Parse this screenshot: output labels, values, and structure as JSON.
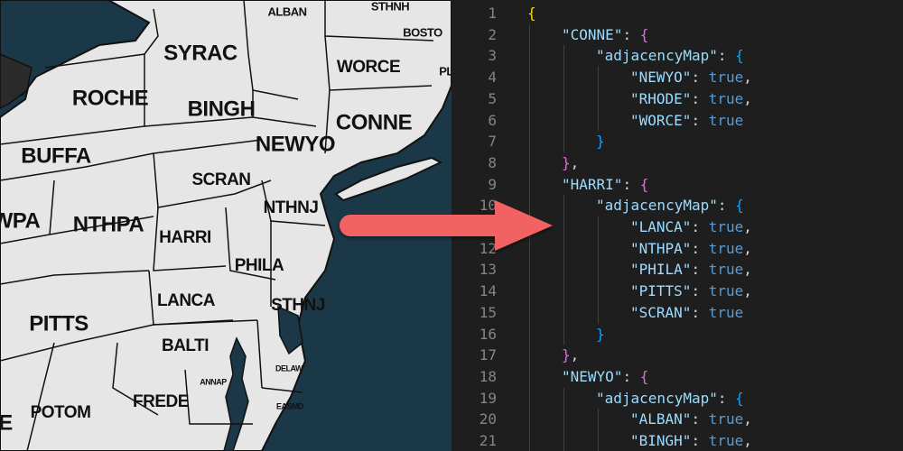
{
  "map": {
    "labels": [
      {
        "id": "alban",
        "text": "ALBAN",
        "size": "small"
      },
      {
        "id": "sthnh",
        "text": "STHNH",
        "size": "small"
      },
      {
        "id": "bosto",
        "text": "BOSTO",
        "size": "small"
      },
      {
        "id": "syrac",
        "text": "SYRAC",
        "size": "large"
      },
      {
        "id": "worce",
        "text": "WORCE",
        "size": "medium"
      },
      {
        "id": "pl",
        "text": "PL",
        "size": "small"
      },
      {
        "id": "roche",
        "text": "ROCHE",
        "size": "large"
      },
      {
        "id": "bingh",
        "text": "BINGH",
        "size": "large"
      },
      {
        "id": "conne",
        "text": "CONNE",
        "size": "large"
      },
      {
        "id": "buffa",
        "text": "BUFFA",
        "size": "large"
      },
      {
        "id": "newyo",
        "text": "NEWYO",
        "size": "large"
      },
      {
        "id": "scran",
        "text": "SCRAN",
        "size": "medium"
      },
      {
        "id": "nthnj",
        "text": "NTHNJ",
        "size": "medium"
      },
      {
        "id": "wpa",
        "text": "WPA",
        "size": "large"
      },
      {
        "id": "nthpa",
        "text": "NTHPA",
        "size": "large"
      },
      {
        "id": "harri",
        "text": "HARRI",
        "size": "medium"
      },
      {
        "id": "phila",
        "text": "PHILA",
        "size": "medium"
      },
      {
        "id": "lanca",
        "text": "LANCA",
        "size": "medium"
      },
      {
        "id": "sthnj",
        "text": "STHNJ",
        "size": "medium"
      },
      {
        "id": "pitts",
        "text": "PITTS",
        "size": "large"
      },
      {
        "id": "balti",
        "text": "BALTI",
        "size": "medium"
      },
      {
        "id": "delaw",
        "text": "DELAW",
        "size": "tiny"
      },
      {
        "id": "annap",
        "text": "ANNAP",
        "size": "tiny"
      },
      {
        "id": "easmd",
        "text": "EASMD",
        "size": "tiny"
      },
      {
        "id": "frede",
        "text": "FREDE",
        "size": "medium"
      },
      {
        "id": "potom",
        "text": "POTOM",
        "size": "medium"
      },
      {
        "id": "e",
        "text": "E",
        "size": "large"
      }
    ]
  },
  "arrow": {
    "color": "#f26262",
    "direction": "right"
  },
  "code": {
    "lines": [
      {
        "n": "1",
        "indent": 0,
        "tokens": [
          {
            "t": "{",
            "c": "b1"
          }
        ]
      },
      {
        "n": "2",
        "indent": 1,
        "tokens": [
          {
            "t": "\"CONNE\"",
            "c": "k"
          },
          {
            "t": ": ",
            "c": "p"
          },
          {
            "t": "{",
            "c": "b2"
          }
        ]
      },
      {
        "n": "3",
        "indent": 2,
        "tokens": [
          {
            "t": "\"adjacencyMap\"",
            "c": "k"
          },
          {
            "t": ": ",
            "c": "p"
          },
          {
            "t": "{",
            "c": "b3"
          }
        ]
      },
      {
        "n": "4",
        "indent": 3,
        "tokens": [
          {
            "t": "\"NEWYO\"",
            "c": "k"
          },
          {
            "t": ": ",
            "c": "p"
          },
          {
            "t": "true",
            "c": "kw"
          },
          {
            "t": ",",
            "c": "p"
          }
        ]
      },
      {
        "n": "5",
        "indent": 3,
        "tokens": [
          {
            "t": "\"RHODE\"",
            "c": "k"
          },
          {
            "t": ": ",
            "c": "p"
          },
          {
            "t": "true",
            "c": "kw"
          },
          {
            "t": ",",
            "c": "p"
          }
        ]
      },
      {
        "n": "6",
        "indent": 3,
        "tokens": [
          {
            "t": "\"WORCE\"",
            "c": "k"
          },
          {
            "t": ": ",
            "c": "p"
          },
          {
            "t": "true",
            "c": "kw"
          }
        ]
      },
      {
        "n": "7",
        "indent": 2,
        "tokens": [
          {
            "t": "}",
            "c": "b3"
          }
        ]
      },
      {
        "n": "8",
        "indent": 1,
        "tokens": [
          {
            "t": "}",
            "c": "b2"
          },
          {
            "t": ",",
            "c": "p"
          }
        ]
      },
      {
        "n": "9",
        "indent": 1,
        "tokens": [
          {
            "t": "\"HARRI\"",
            "c": "k"
          },
          {
            "t": ": ",
            "c": "p"
          },
          {
            "t": "{",
            "c": "b2"
          }
        ]
      },
      {
        "n": "10",
        "indent": 2,
        "tokens": [
          {
            "t": "\"adjacencyMap\"",
            "c": "k"
          },
          {
            "t": ": ",
            "c": "p"
          },
          {
            "t": "{",
            "c": "b3"
          }
        ]
      },
      {
        "n": "11",
        "indent": 3,
        "tokens": [
          {
            "t": "\"LANCA\"",
            "c": "k"
          },
          {
            "t": ": ",
            "c": "p"
          },
          {
            "t": "true",
            "c": "kw"
          },
          {
            "t": ",",
            "c": "p"
          }
        ]
      },
      {
        "n": "12",
        "indent": 3,
        "tokens": [
          {
            "t": "\"NTHPA\"",
            "c": "k"
          },
          {
            "t": ": ",
            "c": "p"
          },
          {
            "t": "true",
            "c": "kw"
          },
          {
            "t": ",",
            "c": "p"
          }
        ]
      },
      {
        "n": "13",
        "indent": 3,
        "tokens": [
          {
            "t": "\"PHILA\"",
            "c": "k"
          },
          {
            "t": ": ",
            "c": "p"
          },
          {
            "t": "true",
            "c": "kw"
          },
          {
            "t": ",",
            "c": "p"
          }
        ]
      },
      {
        "n": "14",
        "indent": 3,
        "tokens": [
          {
            "t": "\"PITTS\"",
            "c": "k"
          },
          {
            "t": ": ",
            "c": "p"
          },
          {
            "t": "true",
            "c": "kw"
          },
          {
            "t": ",",
            "c": "p"
          }
        ]
      },
      {
        "n": "15",
        "indent": 3,
        "tokens": [
          {
            "t": "\"SCRAN\"",
            "c": "k"
          },
          {
            "t": ": ",
            "c": "p"
          },
          {
            "t": "true",
            "c": "kw"
          }
        ]
      },
      {
        "n": "16",
        "indent": 2,
        "tokens": [
          {
            "t": "}",
            "c": "b3"
          }
        ]
      },
      {
        "n": "17",
        "indent": 1,
        "tokens": [
          {
            "t": "}",
            "c": "b2"
          },
          {
            "t": ",",
            "c": "p"
          }
        ]
      },
      {
        "n": "18",
        "indent": 1,
        "tokens": [
          {
            "t": "\"NEWYO\"",
            "c": "k"
          },
          {
            "t": ": ",
            "c": "p"
          },
          {
            "t": "{",
            "c": "b2"
          }
        ]
      },
      {
        "n": "19",
        "indent": 2,
        "tokens": [
          {
            "t": "\"adjacencyMap\"",
            "c": "k"
          },
          {
            "t": ": ",
            "c": "p"
          },
          {
            "t": "{",
            "c": "b3"
          }
        ]
      },
      {
        "n": "20",
        "indent": 3,
        "tokens": [
          {
            "t": "\"ALBAN\"",
            "c": "k"
          },
          {
            "t": ": ",
            "c": "p"
          },
          {
            "t": "true",
            "c": "kw"
          },
          {
            "t": ",",
            "c": "p"
          }
        ]
      },
      {
        "n": "21",
        "indent": 3,
        "tokens": [
          {
            "t": "\"BINGH\"",
            "c": "k"
          },
          {
            "t": ": ",
            "c": "p"
          },
          {
            "t": "true",
            "c": "kw"
          },
          {
            "t": ",",
            "c": "p"
          }
        ]
      }
    ]
  }
}
